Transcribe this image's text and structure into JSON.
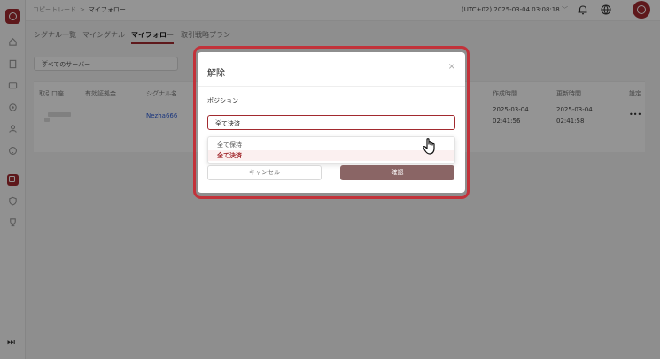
{
  "header": {
    "breadcrumb": [
      "コピートレード",
      "マイフォロー"
    ],
    "timezone": "(UTC+02)",
    "datetime": "2025-03-04 03:08:18",
    "timezone_chevron": "﹀"
  },
  "tabs": [
    {
      "label": "シグナル一覧"
    },
    {
      "label": "マイシグナル"
    },
    {
      "label": "マイフォロー"
    },
    {
      "label": "取引戦略プラン"
    }
  ],
  "filter": {
    "value": "すべてのサーバー",
    "chevron": "﹀"
  },
  "table": {
    "headers": [
      "取引口座",
      "有効証拠金",
      "シグナル名",
      "作成時間",
      "更新時間",
      "設定"
    ],
    "row": {
      "signal": "Nezha666",
      "created_date": "2025-03-04",
      "created_time": "02:41:56",
      "updated_date": "2025-03-04",
      "updated_time": "02:41:58",
      "more": "•••"
    }
  },
  "modal": {
    "title": "解除",
    "close": "×",
    "field_label": "ポジション",
    "selected": "全て決済",
    "select_chevron": "﹀",
    "options": [
      "全て保持",
      "全て決済"
    ],
    "cancel": "キャンセル",
    "confirm": "確認"
  },
  "sidebar": {
    "collapse_glyph": "⏭"
  },
  "colors": {
    "brand": "#a22a2f",
    "highlight": "#c2323a",
    "confirm": "#8a6565"
  }
}
